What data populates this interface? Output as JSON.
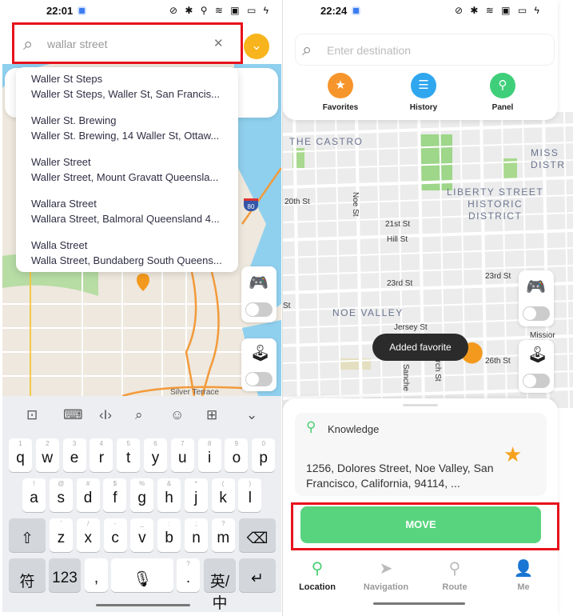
{
  "left": {
    "status": {
      "time": "22:01",
      "icons": "⊘ ✱ ⚲ ≋ ▣ ▭ ϟ"
    },
    "search": {
      "value": "wallar street",
      "clear": "✕"
    },
    "suggestions": [
      {
        "title": "Waller St Steps",
        "subtitle": "Waller St Steps, Waller St, San Francis..."
      },
      {
        "title": "Waller St. Brewing",
        "subtitle": "Waller St. Brewing, 14 Waller St, Ottaw..."
      },
      {
        "title": "Waller Street",
        "subtitle": "Waller Street, Mount Gravatt Queensla..."
      },
      {
        "title": "Wallara Street",
        "subtitle": "Wallara Street, Balmoral Queensland 4..."
      },
      {
        "title": "Walla Street",
        "subtitle": "Walla Street, Bundaberg South Queens..."
      }
    ],
    "map_labels": {
      "highway": "80",
      "area": "Silver Terrace"
    },
    "keyboard": {
      "toolbar": [
        "⊡",
        "⌨",
        "‹I›",
        "⌕",
        "☺",
        "⊞",
        "⌄"
      ],
      "row1": [
        [
          "q",
          "1"
        ],
        [
          "w",
          "2"
        ],
        [
          "e",
          "3"
        ],
        [
          "r",
          "4"
        ],
        [
          "t",
          "5"
        ],
        [
          "y",
          "6"
        ],
        [
          "u",
          "7"
        ],
        [
          "i",
          "8"
        ],
        [
          "o",
          "9"
        ],
        [
          "p",
          "0"
        ]
      ],
      "row2": [
        [
          "a",
          "!"
        ],
        [
          "s",
          "@"
        ],
        [
          "d",
          "#"
        ],
        [
          "f",
          "$"
        ],
        [
          "g",
          "%"
        ],
        [
          "h",
          "&"
        ],
        [
          "j",
          "*"
        ],
        [
          "k",
          "("
        ],
        [
          "l",
          ")"
        ]
      ],
      "row3": [
        [
          "z",
          "'"
        ],
        [
          "x",
          "/"
        ],
        [
          "c",
          "-"
        ],
        [
          "v",
          "_"
        ],
        [
          "b",
          ":"
        ],
        [
          "n",
          ";"
        ],
        [
          "m",
          "?"
        ]
      ],
      "shift": "⇧",
      "backspace": "⌫",
      "symbols": "符",
      "numbers": "123",
      "comma": ",",
      "period": ".",
      "period_hint": "?",
      "lang": "英/中",
      "enter": "↵",
      "mic": "🎙"
    }
  },
  "right": {
    "status": {
      "time": "22:24",
      "icons": "⊘ ✱ ≋ ▣ ▭ ϟ"
    },
    "search": {
      "placeholder": "Enter destination"
    },
    "quick_actions": [
      {
        "label": "Favorites",
        "color": "#f6952b",
        "icon": "★"
      },
      {
        "label": "History",
        "color": "#2fa7ef",
        "icon": "☰"
      },
      {
        "label": "Panel",
        "color": "#3fcf7a",
        "icon": "⚲"
      }
    ],
    "map_labels": {
      "castro": "THE CASTRO",
      "mission": "MISS\nDISTR",
      "liberty": "LIBERTY STREET\nHISTORIC\nDISTRICT",
      "noe_valley": "NOE VALLEY",
      "st20": "20th St",
      "noe_st": "Noe St",
      "st21": "21st St",
      "hill": "Hill St",
      "st23a": "23rd St",
      "st23b": "23rd St",
      "jersey": "Jersey St",
      "st26": "26th St",
      "sanchez": "Sanche",
      "church": "urch St",
      "st_left": "St",
      "mission_st": "Missior"
    },
    "toast": "Added favorite",
    "location_card": {
      "name": "Knowledge",
      "address": "1256, Dolores Street, Noe Valley, San Francisco, California, 94114, ..."
    },
    "move_button": "MOVE",
    "tabs": [
      {
        "label": "Location",
        "active": true,
        "icon": "location-pin"
      },
      {
        "label": "Navigation",
        "active": false,
        "icon": "paper-plane"
      },
      {
        "label": "Route",
        "active": false,
        "icon": "route"
      },
      {
        "label": "Me",
        "active": false,
        "icon": "person"
      }
    ],
    "accent": "#58d47e"
  }
}
